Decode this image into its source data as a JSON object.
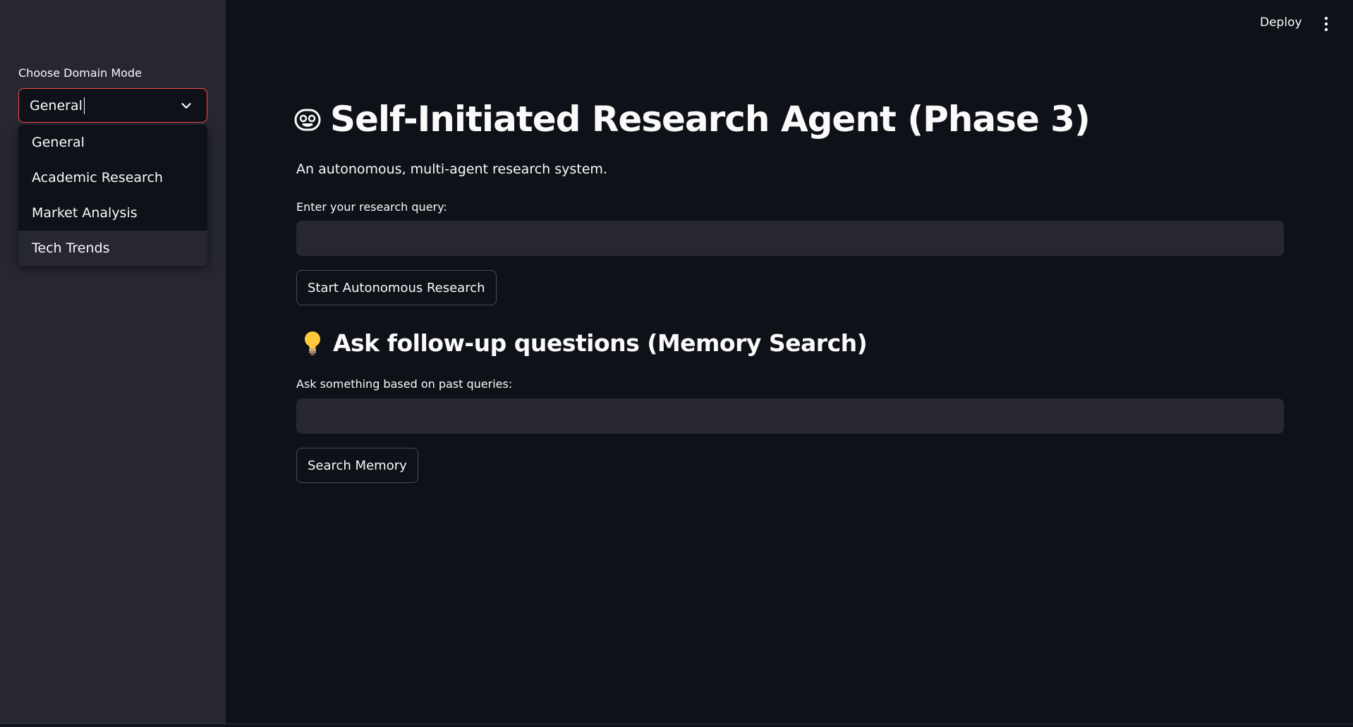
{
  "sidebar": {
    "label": "Choose Domain Mode",
    "select_value": "General",
    "options": [
      "General",
      "Academic Research",
      "Market Analysis",
      "Tech Trends"
    ]
  },
  "topbar": {
    "deploy_label": "Deploy",
    "menu_icon": "vertical-dots-icon"
  },
  "main": {
    "title": "Self-Initiated Research Agent (Phase 3)",
    "title_icon": "robot-face-icon",
    "subtitle": "An autonomous, multi-agent research system.",
    "query_label": "Enter your research query:",
    "query_value": "",
    "start_button": "Start Autonomous Research",
    "followup_title": "Ask follow-up questions (Memory Search)",
    "followup_icon": "lightbulb-icon",
    "memory_label": "Ask something based on past queries:",
    "memory_value": "",
    "search_button": "Search Memory"
  },
  "colors": {
    "background": "#0e1117",
    "sidebar": "#262730",
    "input": "#262730",
    "focus_border": "#ff4b4b"
  }
}
